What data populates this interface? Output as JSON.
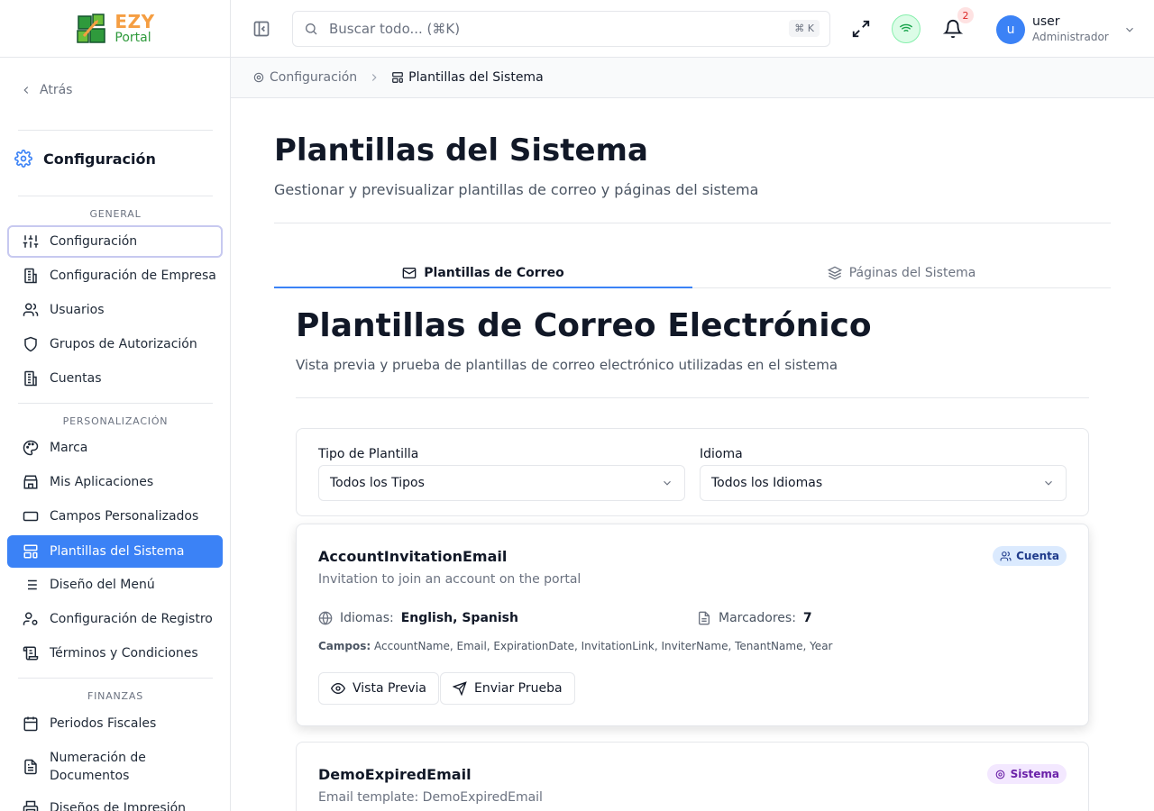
{
  "brand": {
    "name_top": "EZY",
    "name_bottom": "Portal"
  },
  "sidebar": {
    "back_label": "Atrás",
    "header": "Configuración",
    "sections": {
      "general": "GENERAL",
      "personalizacion": "PERSONALIZACIÓN",
      "finanzas": "FINANZAS"
    },
    "items": {
      "configuracion": "Configuración",
      "empresa": "Configuración de Empresa",
      "usuarios": "Usuarios",
      "grupos": "Grupos de Autorización",
      "cuentas": "Cuentas",
      "marca": "Marca",
      "aplicaciones": "Mis Aplicaciones",
      "campos": "Campos Personalizados",
      "plantillas": "Plantillas del Sistema",
      "menu": "Diseño del Menú",
      "registro": "Configuración de Registro",
      "terminos": "Términos y Condiciones",
      "periodos": "Periodos Fiscales",
      "numeracion_1": "Numeración de",
      "numeracion_2": "Documentos",
      "disenos": "Diseños de Impresión"
    },
    "active_item": "Plantillas del Sistema"
  },
  "topbar": {
    "search_placeholder": "Buscar todo... (⌘K)",
    "search_shortcut": "⌘ K",
    "notification_count": "2",
    "user_initial": "u",
    "user_name": "user",
    "user_role": "Administrador"
  },
  "breadcrumb": {
    "parent": "Configuración",
    "current": "Plantillas del Sistema"
  },
  "page": {
    "title": "Plantillas del Sistema",
    "subtitle": "Gestionar y previsualizar plantillas de correo y páginas del sistema",
    "tabs": [
      "Plantillas de Correo",
      "Páginas del Sistema"
    ],
    "active_tab": "Plantillas de Correo"
  },
  "email_section": {
    "title": "Plantillas de Correo Electrónico",
    "subtitle": "Vista previa y prueba de plantillas de correo electrónico utilizadas en el sistema",
    "filters": {
      "type_label": "Tipo de Plantilla",
      "type_value": "Todos los Tipos",
      "lang_label": "Idioma",
      "lang_value": "Todos los Idiomas"
    },
    "templates": [
      {
        "name": "AccountInvitationEmail",
        "description": "Invitation to join an account on the portal",
        "badge": "Cuenta",
        "languages_label": "Idiomas:",
        "languages": "English, Spanish",
        "placeholders_label": "Marcadores:",
        "placeholders": "7",
        "fields_label": "Campos:",
        "fields": "AccountName, Email, ExpirationDate, InvitationLink, InviterName, TenantName, Year",
        "preview_label": "Vista Previa",
        "send_label": "Enviar Prueba"
      },
      {
        "name": "DemoExpiredEmail",
        "description": "Email template: DemoExpiredEmail",
        "badge": "Sistema"
      }
    ]
  },
  "colors": {
    "accent": "#3b82f6",
    "brand_orange": "#f59e42",
    "brand_green": "#2f9a3c",
    "badge_blue_bg": "#dbeafe",
    "badge_purple_bg": "#f3e8ff"
  },
  "icons": {
    "back": "chevron-left-icon",
    "settings": "gear-icon",
    "search": "search-icon",
    "expand": "expand-icon",
    "wifi": "wifi-icon",
    "bell": "bell-icon",
    "mail": "mail-icon",
    "layers": "layers-icon",
    "globe": "globe-icon",
    "file": "file-text-icon",
    "eye": "eye-icon",
    "send": "send-icon"
  }
}
